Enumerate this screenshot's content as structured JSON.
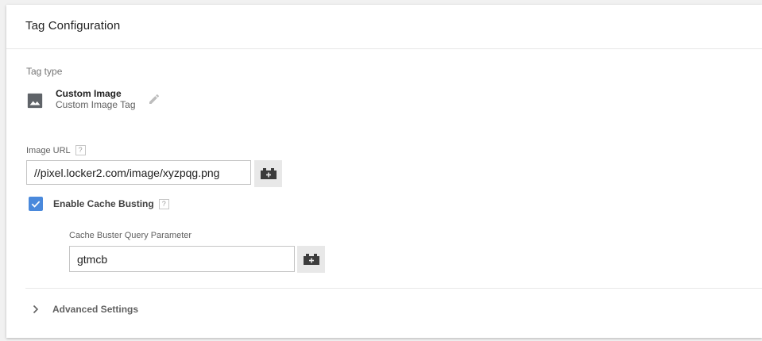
{
  "card": {
    "title": "Tag Configuration"
  },
  "tag_type": {
    "section_label": "Tag type",
    "name": "Custom Image",
    "subtitle": "Custom Image Tag",
    "icon": "image-icon"
  },
  "image_url": {
    "label": "Image URL",
    "help": "?",
    "value": "//pixel.locker2.com/image/xyzpqg.png"
  },
  "cache_busting": {
    "label": "Enable Cache Busting",
    "help": "?",
    "checked": true,
    "param_label": "Cache Buster Query Parameter",
    "param_value": "gtmcb"
  },
  "advanced": {
    "label": "Advanced Settings"
  },
  "colors": {
    "accent": "#4a89dc",
    "background": "#f1f1f1",
    "card": "#ffffff"
  }
}
